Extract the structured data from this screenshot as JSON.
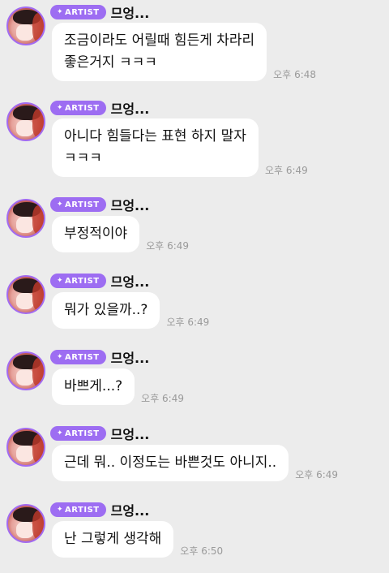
{
  "badge_label": "ARTIST",
  "sender": "므엉...",
  "colors": {
    "background": "#ececec",
    "bubble": "#ffffff",
    "badge": "#9d6df2",
    "avatar_ring": "#a26bf0"
  },
  "messages": [
    {
      "text": "조금이라도 어릴때 힘든게 차라리\n좋은거지 ㅋㅋㅋ",
      "time": "오후 6:48"
    },
    {
      "text": "아니다 힘들다는 표현 하지 말자\nㅋㅋㅋ",
      "time": "오후 6:49"
    },
    {
      "text": "부정적이야",
      "time": "오후 6:49"
    },
    {
      "text": "뭐가 있을까..?",
      "time": "오후 6:49"
    },
    {
      "text": "바쁘게...?",
      "time": "오후 6:49"
    },
    {
      "text": "근데 뭐.. 이정도는 바쁜것도 아니지..",
      "time": "오후 6:49"
    },
    {
      "text": "난 그렇게 생각해",
      "time": "오후 6:50"
    }
  ]
}
